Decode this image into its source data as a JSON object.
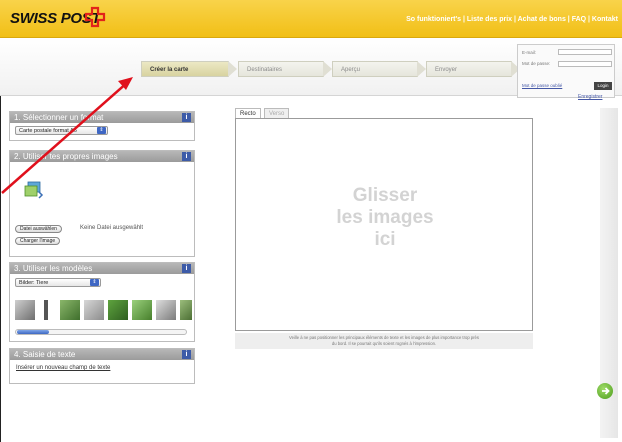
{
  "header": {
    "logo_text": "SWISS POST",
    "links": "So funktioniert's | Liste des prix | Achat de bons | FAQ | Kontakt",
    "brand_color": "#f3c41f",
    "logo_cross_color": "#e2231a"
  },
  "steps": [
    {
      "label": "Créer la carte",
      "active": true
    },
    {
      "label": "Destinataires",
      "active": false
    },
    {
      "label": "Aperçu",
      "active": false
    },
    {
      "label": "Envoyer",
      "active": false
    }
  ],
  "login": {
    "email_label": "E-mail:",
    "password_label": "Mot de passe:",
    "forgot_label": "Mot de passe oublié",
    "login_button": "Login",
    "register_link": "Enregistrer"
  },
  "panels": {
    "format": {
      "title": "1. Sélectionner un format",
      "select_value": "Carte postale format A6"
    },
    "images": {
      "title": "2. Utiliser tes propres images",
      "file_button": "Datei auswählen",
      "file_status": "Keine Datei ausgewählt",
      "upload_button": "Charger l'image"
    },
    "models": {
      "title": "3. Utiliser les modèles",
      "select_value": "Bilder: Tiere"
    },
    "text": {
      "title": "4. Saisie de texte",
      "link": "Insérer un nouveau champ de texte"
    }
  },
  "editor": {
    "tab_front": "Recto",
    "tab_back": "Verso",
    "drop_line1": "Glisser",
    "drop_line2": "les images",
    "drop_line3": "ici",
    "note_line1": "Veille à ne pas positionner les principaux éléments de texte et les images de plus importance trop près",
    "note_line2": "du bord. Il se pourrait qu'ils soient rognés à l'impression."
  },
  "icons": {
    "info": "info-icon",
    "next": "next-arrow-icon",
    "upload": "upload-image-icon"
  },
  "annotation_color": "#e0101c"
}
